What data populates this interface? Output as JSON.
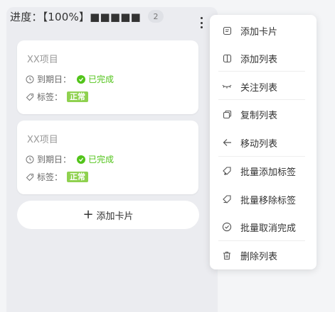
{
  "column": {
    "title": "进度：【100%】■■■■■",
    "count": "2"
  },
  "cards": [
    {
      "name": "XX项目",
      "due_label": "到期日：",
      "status": "已完成",
      "tag_label": "标签：",
      "tag": "正常"
    },
    {
      "name": "XX项目",
      "due_label": "到期日：",
      "status": "已完成",
      "tag_label": "标签：",
      "tag": "正常"
    }
  ],
  "add_card_label": "添加卡片",
  "menu": {
    "items": [
      {
        "label": "添加卡片",
        "icon": "card-icon"
      },
      {
        "label": "添加列表",
        "icon": "columns-icon"
      },
      {
        "label": "关注列表",
        "icon": "eye-closed-icon"
      },
      {
        "label": "复制列表",
        "icon": "copy-icon"
      },
      {
        "label": "移动列表",
        "icon": "arrow-left-icon"
      },
      {
        "label": "批量添加标签",
        "icon": "tag-add-icon"
      },
      {
        "label": "批量移除标签",
        "icon": "tag-remove-icon"
      },
      {
        "label": "批量取消完成",
        "icon": "check-circle-icon"
      },
      {
        "label": "删除列表",
        "icon": "trash-icon"
      }
    ]
  },
  "colors": {
    "success": "#52c41a",
    "tag": "#8fd14f",
    "column_bg": "#ebecf0"
  }
}
